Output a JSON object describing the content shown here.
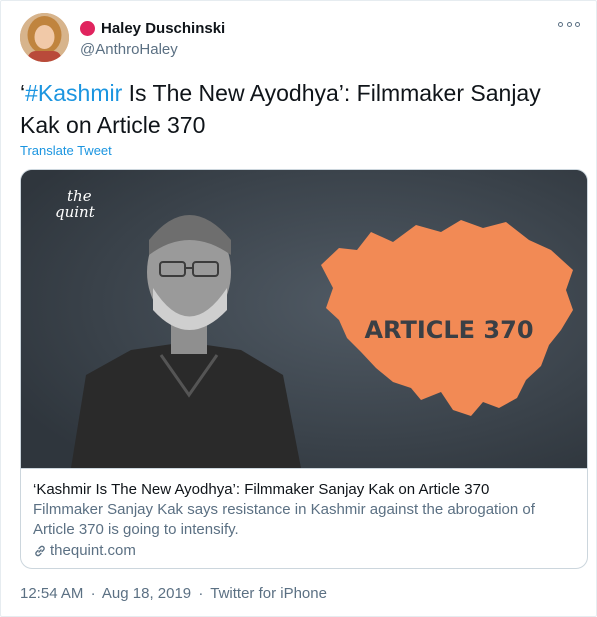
{
  "user": {
    "display_name": "Haley Duschinski",
    "handle": "@AnthroHaley",
    "status_color": "#e0245e"
  },
  "tweet": {
    "text_open_quote": "‘",
    "hashtag": "#Kashmir",
    "text_rest": " Is The New Ayodhya’: Filmmaker Sanjay Kak on Article 370",
    "translate_label": "Translate Tweet"
  },
  "card": {
    "image": {
      "logo_line1": "the",
      "logo_line2": "quint",
      "map_label": "ARTICLE 370",
      "map_color": "#f28a55"
    },
    "title": "‘Kashmir Is The New Ayodhya’: Filmmaker Sanjay Kak on Article 370",
    "description": "Filmmaker Sanjay Kak says resistance in Kashmir against the abrogation of Article 370 is going to intensify.",
    "domain": "thequint.com"
  },
  "meta": {
    "time": "12:54 AM",
    "separator": "·",
    "date": "Aug 18, 2019",
    "separator2": "·",
    "source": "Twitter for iPhone"
  },
  "icons": {
    "more": "more-icon",
    "link": "link-icon",
    "status": "status-dot-icon"
  }
}
